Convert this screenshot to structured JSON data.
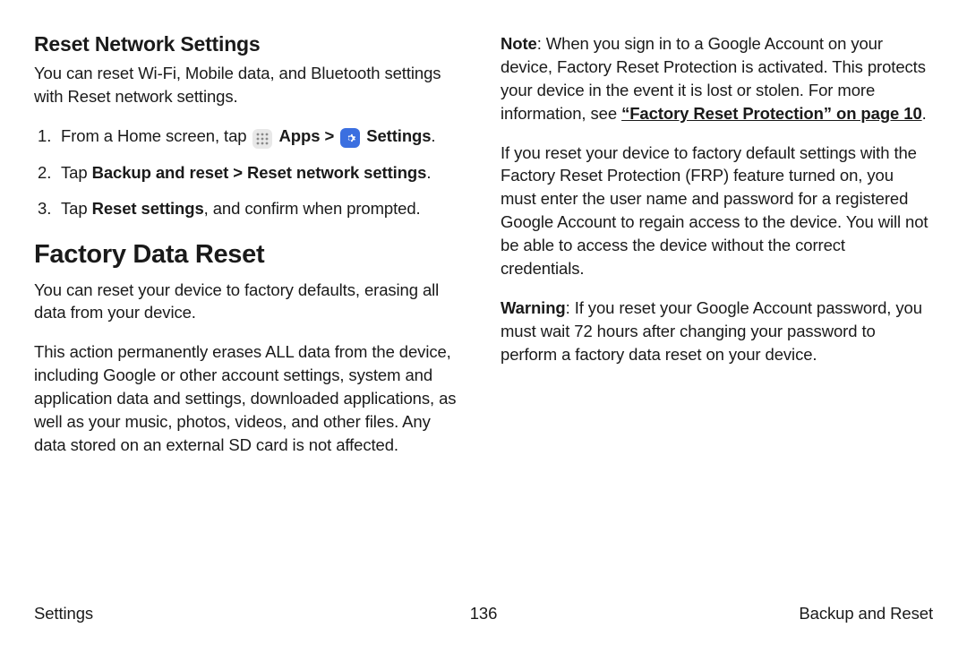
{
  "leftCol": {
    "section1": {
      "heading": "Reset Network Settings",
      "intro": "You can reset Wi-Fi, Mobile data, and Bluetooth settings with Reset network settings.",
      "step1_pre": "From a Home screen, tap ",
      "step1_apps": "Apps",
      "step1_sep": " > ",
      "step1_settings": "Settings",
      "step1_end": ".",
      "step2_pre": "Tap ",
      "step2_bold": "Backup and reset > Reset network settings",
      "step2_end": ".",
      "step3_pre": "Tap ",
      "step3_bold": "Reset settings",
      "step3_end": ", and confirm when prompted."
    },
    "section2": {
      "heading": "Factory Data Reset",
      "p1": "You can reset your device to factory defaults, erasing all data from your device.",
      "p2": "This action permanently erases ALL data from the device, including Google or other account settings, system and application data and settings, downloaded applications, as well as your music, photos, videos, and other files. Any data stored on an external SD card is not affected."
    }
  },
  "rightCol": {
    "note_label": "Note",
    "note_body_a": ": When you sign in to a Google Account on your device, Factory Reset Protection is activated. This protects your device in the event it is lost or stolen. For more information, see ",
    "note_link": "“Factory Reset Protection” on page 10",
    "note_body_b": ".",
    "p2": "If you reset your device to factory default settings with the Factory Reset Protection (FRP) feature turned on, you must enter the user name and password for a registered Google Account to regain access to the device. You will not be able to access the device without the correct credentials.",
    "warn_label": "Warning",
    "warn_body": ": If you reset your Google Account password, you must wait 72 hours after changing your password to perform a factory data reset on your device."
  },
  "footer": {
    "left": "Settings",
    "center": "136",
    "right": "Backup and Reset"
  }
}
